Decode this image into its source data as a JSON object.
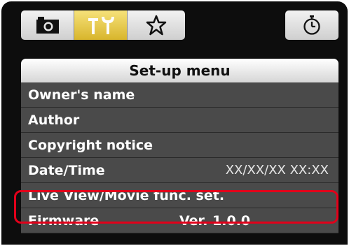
{
  "tabs": [
    {
      "name": "shooting",
      "icon": "camera-icon",
      "selected": false
    },
    {
      "name": "set-up",
      "icon": "wrench-icon",
      "selected": true
    },
    {
      "name": "my-menu",
      "icon": "star-icon",
      "selected": false
    },
    {
      "name": "timer",
      "icon": "stopwatch-icon",
      "selected": false
    }
  ],
  "menu": {
    "title": "Set-up menu",
    "items": [
      {
        "label": "Owner's name",
        "value": ""
      },
      {
        "label": "Author",
        "value": ""
      },
      {
        "label": "Copyright notice",
        "value": ""
      },
      {
        "label": "Date/Time",
        "value": "XX/XX/XX XX:XX"
      },
      {
        "label": "Live View/Movie func. set.",
        "value": "",
        "highlighted": true
      },
      {
        "label": "Firmware",
        "value": "Ver. 1.0.0"
      }
    ]
  },
  "colors": {
    "background": "#0d0d0d",
    "row": "#4a4a4a",
    "selected_tab": "#e8c84a",
    "highlight": "#e2001a"
  }
}
